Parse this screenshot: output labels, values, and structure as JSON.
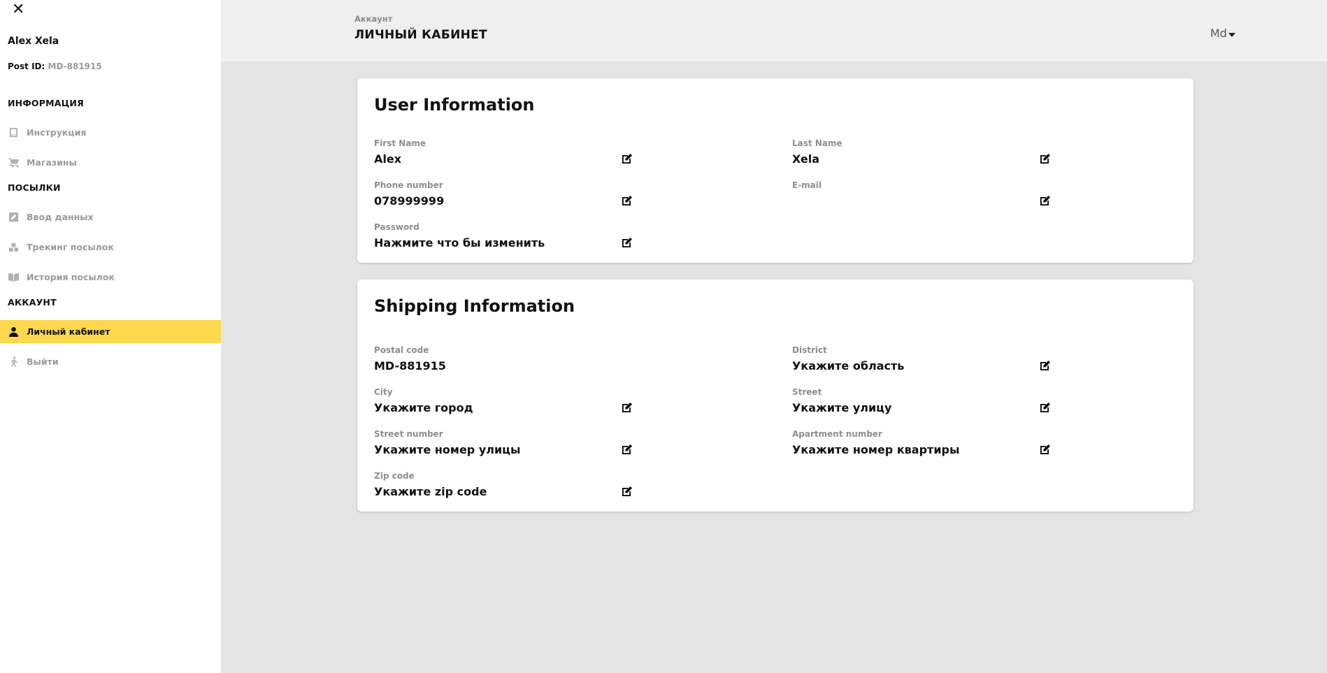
{
  "sidebar": {
    "close_label": "✕",
    "user_name": "Alex Xela",
    "post_id_label": "Post ID:",
    "post_id_value": "MD-881915",
    "sections": {
      "info": "ИНФОРМАЦИЯ",
      "parcels": "ПОСЫЛКИ",
      "account": "АККАУНТ"
    },
    "items": [
      {
        "label": "Инструкция",
        "icon": "book-icon"
      },
      {
        "label": "Магазины",
        "icon": "cart-icon"
      },
      {
        "label": "Ввод данных",
        "icon": "edit-icon"
      },
      {
        "label": "Трекинг посылок",
        "icon": "boxes-icon"
      },
      {
        "label": "История посылок",
        "icon": "open-book-icon"
      },
      {
        "label": "Личный кабинет",
        "icon": "user-icon",
        "active": true
      },
      {
        "label": "Выйти",
        "icon": "walk-icon"
      }
    ]
  },
  "header": {
    "breadcrumb": "Аккаунт",
    "title": "ЛИЧНЫЙ КАБИНЕТ",
    "language": "Md"
  },
  "user_info": {
    "title": "User Information",
    "fields": [
      {
        "label": "First Name",
        "value": "Alex"
      },
      {
        "label": "Last Name",
        "value": "Xela"
      },
      {
        "label": "Phone number",
        "value": "078999999"
      },
      {
        "label": "E-mail",
        "value": ""
      },
      {
        "label": "Password",
        "value": "Нажмите что бы изменить"
      }
    ]
  },
  "shipping_info": {
    "title": "Shipping Information",
    "fields": [
      {
        "label": "Postal code",
        "value": "MD-881915"
      },
      {
        "label": "District",
        "value": "Укажите область"
      },
      {
        "label": "City",
        "value": "Укажите город"
      },
      {
        "label": "Street",
        "value": "Укажите улицу"
      },
      {
        "label": "Street number",
        "value": "Укажите номер улицы"
      },
      {
        "label": "Apartment number",
        "value": "Укажите номер квартиры"
      },
      {
        "label": "Zip code",
        "value": "Укажите zip code"
      }
    ]
  },
  "colors": {
    "accent": "#ffd84d",
    "background": "#e4e4e4",
    "header_bg": "#efefef"
  }
}
